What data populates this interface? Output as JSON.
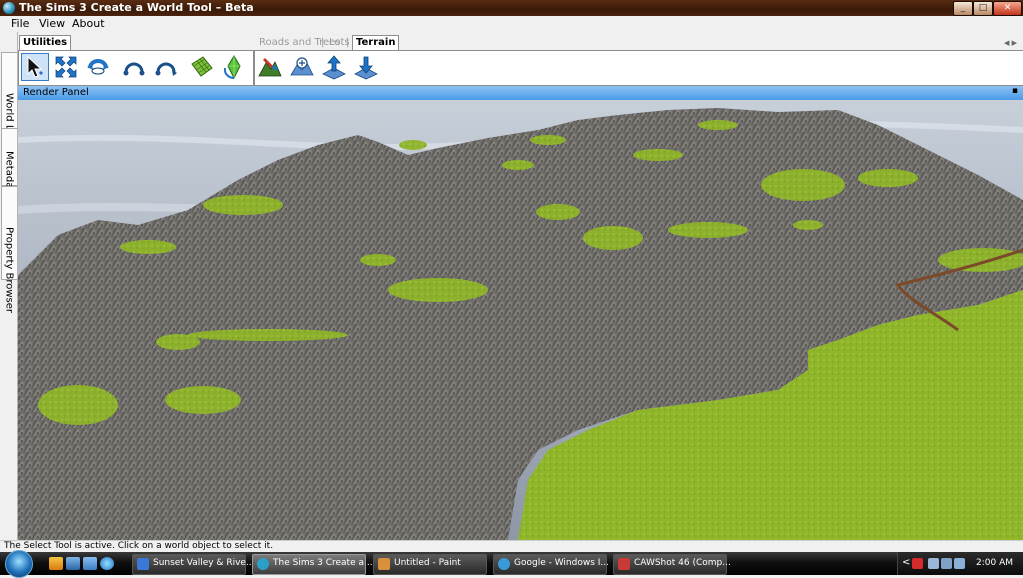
{
  "window": {
    "title": "The Sims 3 Create a World Tool – Beta"
  },
  "menu": {
    "file": "File",
    "view": "View",
    "about": "About"
  },
  "side_tabs": [
    "World Layers",
    "Metadata",
    "Property Browser"
  ],
  "tabs": {
    "utilities": "Utilities",
    "roads_and_trees": "Roads and Trees",
    "lots": "Lots",
    "terrain": "Terrain",
    "separator": "|"
  },
  "tools": {
    "utilities": [
      "select-tool",
      "scale-tool",
      "rotate-tool",
      "undo-arc-tool",
      "redo-arc-tool",
      "terrain-grid-tool",
      "sim-tool"
    ],
    "terrain": [
      "terrain-paint-tool",
      "terrain-smooth-tool",
      "terrain-raise-tool",
      "terrain-lower-tool"
    ]
  },
  "render_panel": {
    "title": "Render Panel",
    "pin": "▪"
  },
  "status": {
    "text": "The Select Tool is active. Click on a world object to select it."
  },
  "taskbar": {
    "tasks": [
      {
        "label": "Sunset Valley & Rive...",
        "icon_color": "#3a78d8"
      },
      {
        "label": "The Sims 3 Create a ...",
        "icon_color": "#2aa0c8"
      },
      {
        "label": "Untitled - Paint",
        "icon_color": "#d8903a"
      },
      {
        "label": "Google - Windows I...",
        "icon_color": "#3a9ad8"
      },
      {
        "label": "CAWShot 46 (Comp...",
        "icon_color": "#c83a3a"
      }
    ],
    "tray": {
      "arrow": "<",
      "clock": "2:00 AM"
    }
  },
  "colors": {
    "accent": "#4a9be8",
    "title_bar": "#4b230e",
    "grass": "#8fb52a",
    "rock": "#6f6d6a"
  }
}
